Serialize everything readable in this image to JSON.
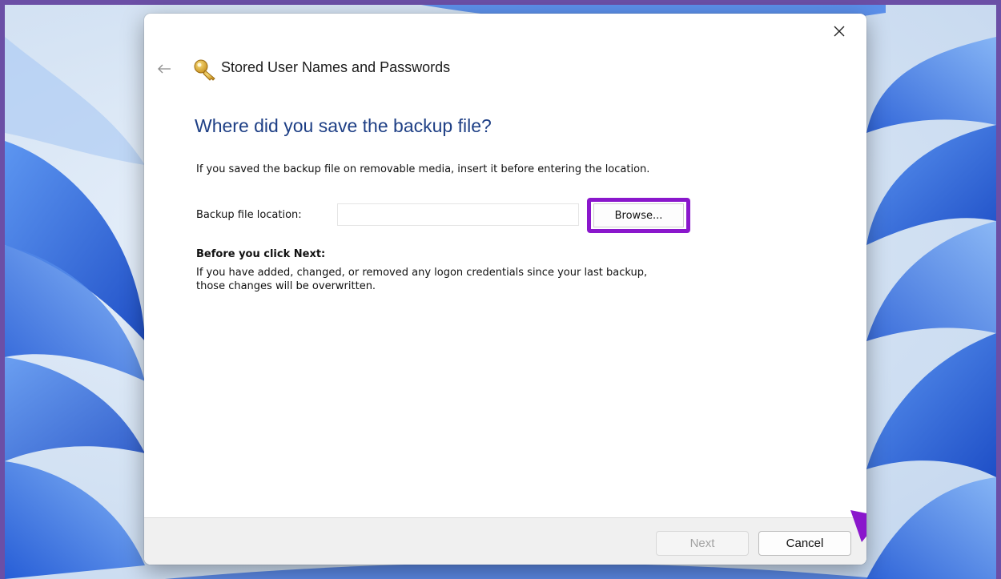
{
  "window": {
    "title": "Stored User Names and Passwords",
    "close_icon": "close-icon",
    "back_icon": "back-arrow-icon",
    "app_icon": "key-icon"
  },
  "page": {
    "heading": "Where did you save the backup file?",
    "description": "If you saved the backup file on removable media, insert it before entering the location.",
    "location_label": "Backup file location:",
    "location_value": "",
    "browse_label": "Browse...",
    "before_heading": "Before you click Next:",
    "before_text": "If you have added, changed, or removed any logon credentials since your last backup, those changes will be overwritten."
  },
  "footer": {
    "next_label": "Next",
    "next_enabled": false,
    "cancel_label": "Cancel"
  },
  "annotations": {
    "highlight_color": "#8a17cc",
    "arrow_color": "#8a17cc"
  },
  "colors": {
    "heading": "#1e3f85",
    "wallpaper_accent": "#1a56d6"
  }
}
